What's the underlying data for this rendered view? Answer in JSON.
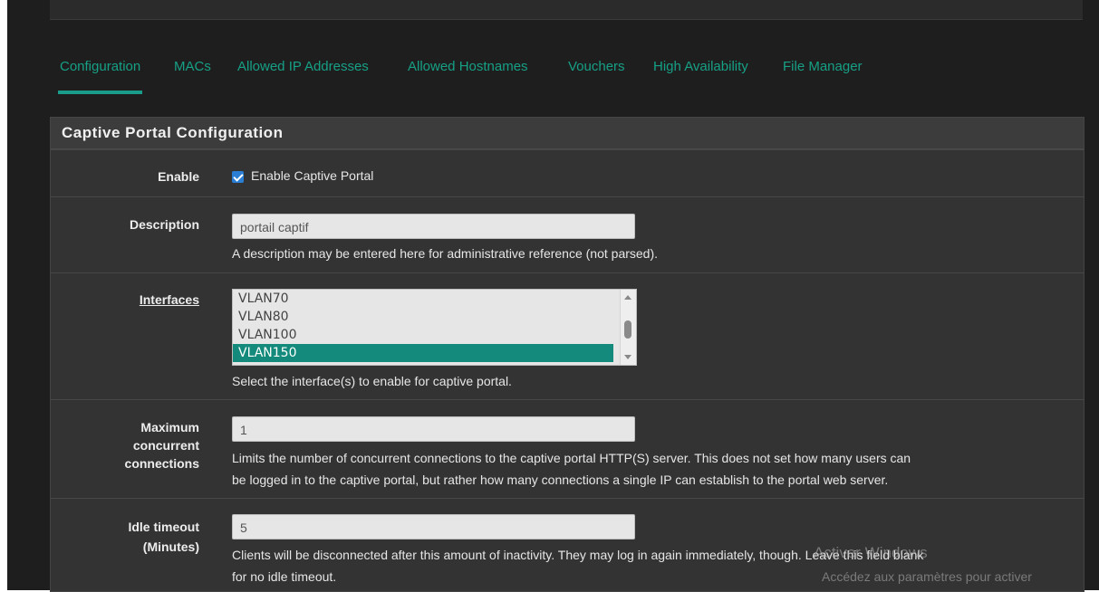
{
  "tabs": [
    {
      "label": "Configuration",
      "active": true
    },
    {
      "label": "MACs"
    },
    {
      "label": "Allowed IP Addresses"
    },
    {
      "label": "Allowed Hostnames"
    },
    {
      "label": "Vouchers"
    },
    {
      "label": "High Availability"
    },
    {
      "label": "File Manager"
    }
  ],
  "panel": {
    "title": "Captive Portal Configuration"
  },
  "enable": {
    "label": "Enable",
    "checkbox_label": "Enable Captive Portal",
    "checked": true
  },
  "description": {
    "label": "Description",
    "value": "portail captif",
    "help": "A description may be entered here for administrative reference (not parsed)."
  },
  "interfaces": {
    "label": "Interfaces",
    "options": [
      "VLAN70",
      "VLAN80",
      "VLAN100",
      "VLAN150"
    ],
    "selected": "VLAN150",
    "help": "Select the interface(s) to enable for captive portal."
  },
  "max_conn": {
    "label_1": "Maximum",
    "label_2": "concurrent",
    "label_3": "connections",
    "value": "1",
    "help_1": "Limits the number of concurrent connections to the captive portal HTTP(S) server. This does not set how many users can",
    "help_2": "be logged in to the captive portal, but rather how many connections a single IP can establish to the portal web server."
  },
  "idle_timeout": {
    "label_1": "Idle timeout",
    "label_2": "(Minutes)",
    "value": "5",
    "help_1": "Clients will be disconnected after this amount of inactivity. They may log in again immediately, though. Leave this field blank",
    "help_2": "for no idle timeout."
  },
  "watermark": {
    "line1": "Activer Windows",
    "line2": "Accédez aux paramètres pour activer"
  },
  "colors": {
    "accent": "#16a085",
    "selection": "#138a7b",
    "checkbox": "#2a7fd4"
  }
}
